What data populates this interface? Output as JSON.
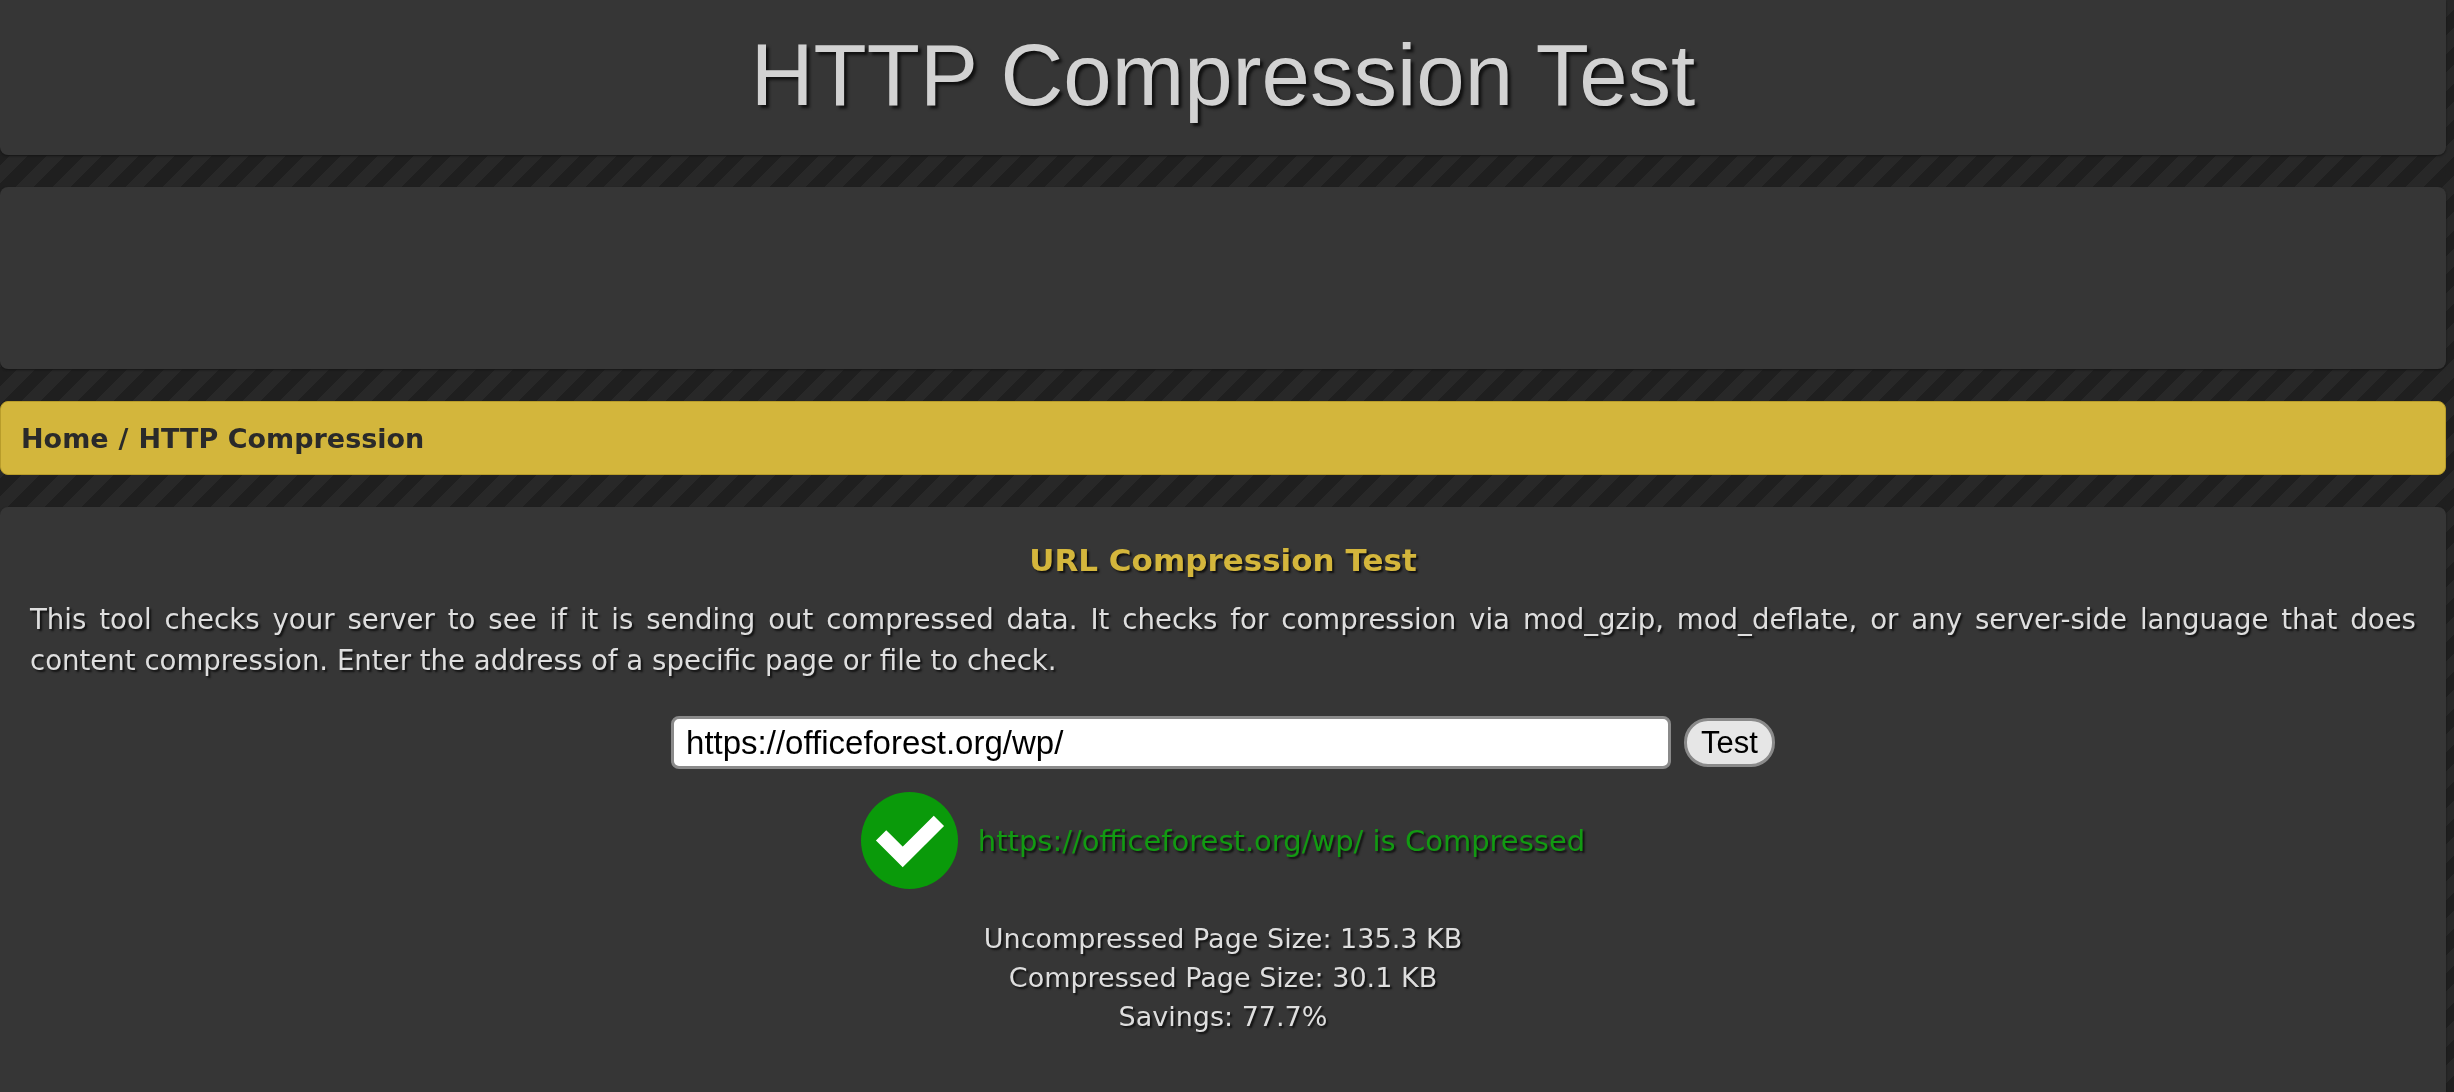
{
  "header": {
    "title": "HTTP Compression Test"
  },
  "breadcrumb": {
    "items": [
      {
        "label": "Home"
      },
      {
        "label": "HTTP Compression"
      }
    ],
    "separator": "/"
  },
  "tool": {
    "heading": "URL Compression Test",
    "description": "This tool checks your server to see if it is sending out compressed data. It checks for compression via mod_gzip, mod_deflate, or any server-side language that does content compression. Enter the address of a specific page or file to check.",
    "url_field": {
      "value": "https://officeforest.org/wp/"
    },
    "button": "Test",
    "result": {
      "compressed": true,
      "message": "https://officeforest.org/wp/ is Compressed"
    },
    "stats": [
      "Uncompressed Page Size: 135.3 KB",
      "Compressed Page Size: 30.1 KB",
      "Savings: 77.7%"
    ]
  }
}
